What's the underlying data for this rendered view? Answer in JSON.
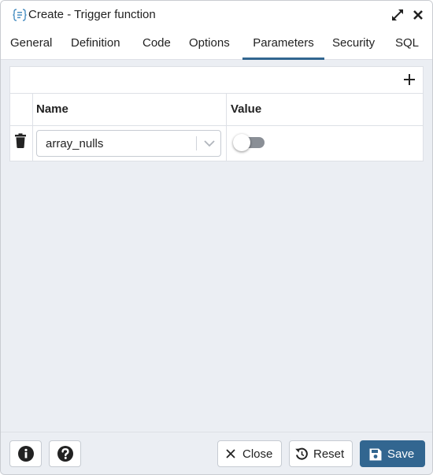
{
  "window": {
    "title": "Create - Trigger function",
    "icon": "trigger-function-icon"
  },
  "titlebar_buttons": {
    "expand_icon": "expand-icon",
    "close_icon": "close-icon"
  },
  "tabs": [
    {
      "label": "General"
    },
    {
      "label": "Definition"
    },
    {
      "label": "Code"
    },
    {
      "label": "Options"
    },
    {
      "label": "Parameters",
      "active": true
    },
    {
      "label": "Security"
    },
    {
      "label": "SQL"
    }
  ],
  "parameters": {
    "add_icon": "plus-icon",
    "columns": {
      "name": "Name",
      "value": "Value"
    },
    "rows": [
      {
        "name": "array_nulls",
        "value_enabled": false
      }
    ]
  },
  "footer": {
    "info_icon": "info-icon",
    "help_icon": "help-icon",
    "close_label": "Close",
    "reset_label": "Reset",
    "save_label": "Save"
  },
  "colors": {
    "accent": "#326690",
    "background": "#ebeef3",
    "border": "#dde0e6"
  }
}
